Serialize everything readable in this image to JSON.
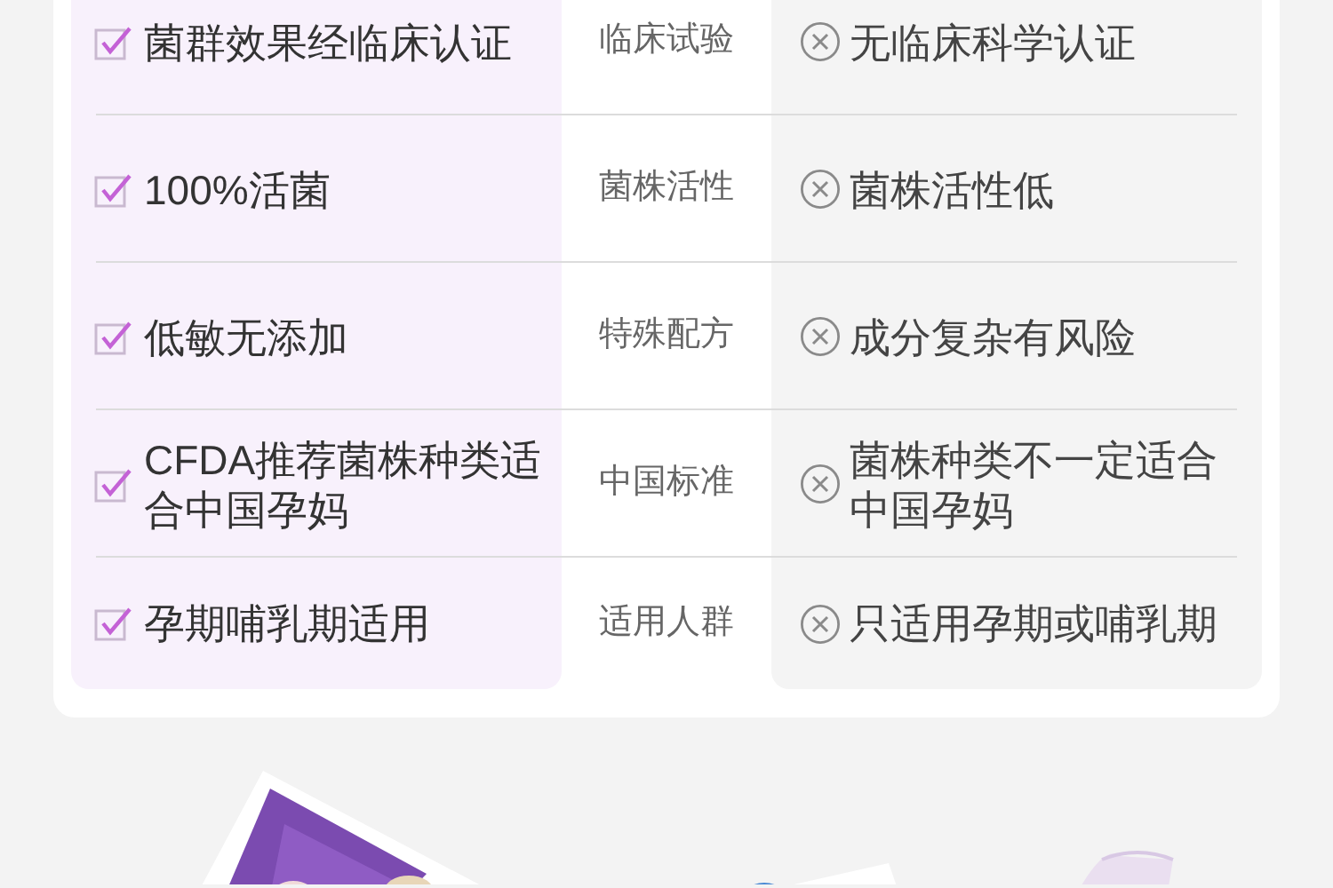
{
  "comparison": {
    "rows": [
      {
        "feature": "菌群效果经临床认证",
        "category": "临床试验",
        "competitor": "无临床科学认证"
      },
      {
        "feature": "100%活菌",
        "category": "菌株活性",
        "competitor": "菌株活性低"
      },
      {
        "feature": "低敏无添加",
        "category": "特殊配方",
        "competitor": "成分复杂有风险"
      },
      {
        "feature": "CFDA推荐菌株种类适合中国孕妈",
        "category": "中国标准",
        "competitor": "菌株种类不一定适合中国孕妈"
      },
      {
        "feature": "孕期哺乳期适用",
        "category": "适用人群",
        "competitor": "只适用孕期或哺乳期"
      }
    ]
  }
}
